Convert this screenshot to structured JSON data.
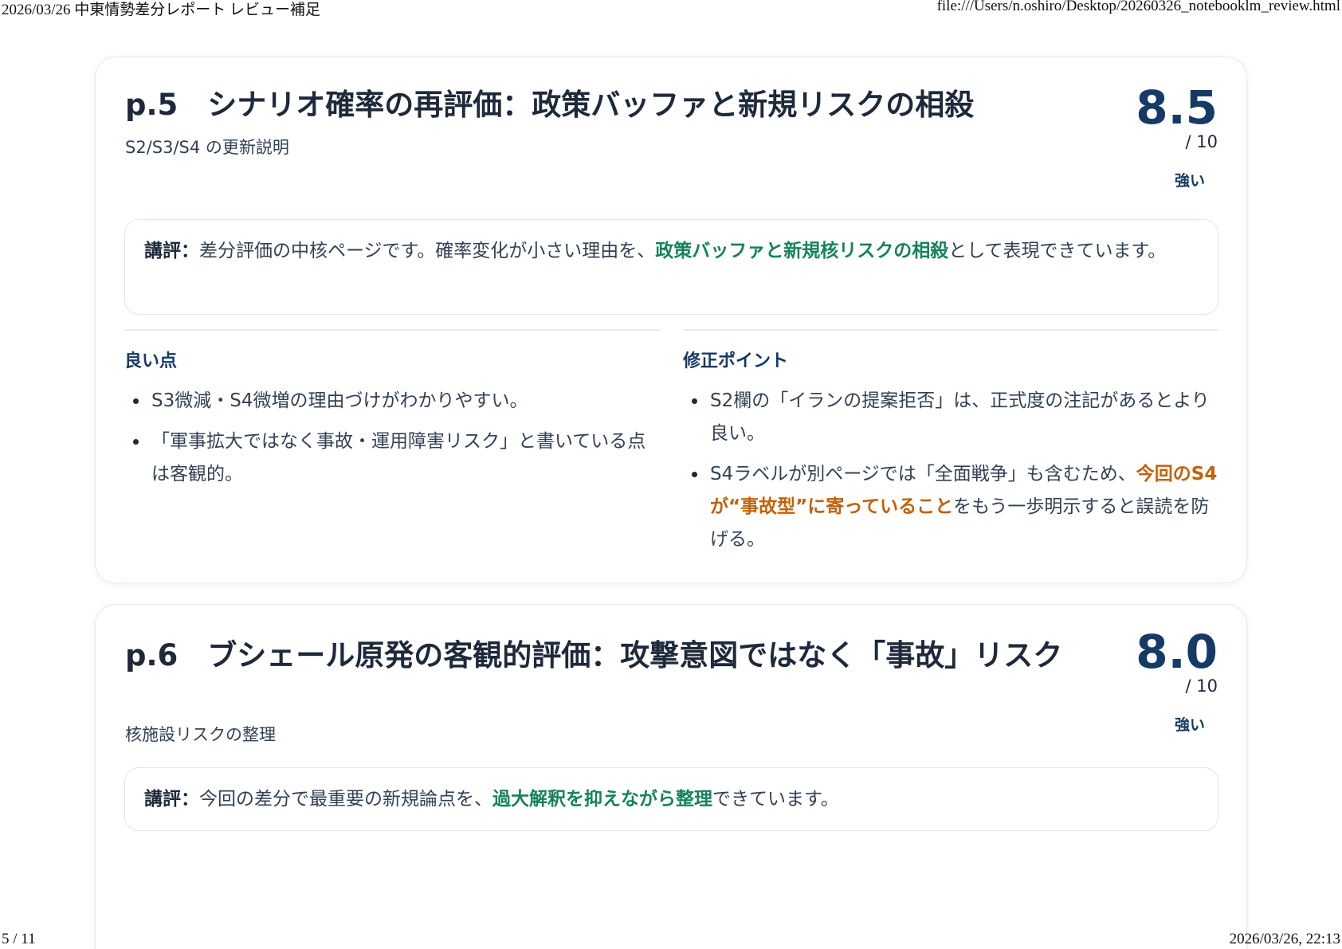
{
  "print_header": {
    "title": "2026/03/26 中東情勢差分レポート レビュー補足",
    "url": "file:///Users/n.oshiro/Desktop/20260326_notebooklm_review.html"
  },
  "print_footer": {
    "page": "5 / 11",
    "datetime": "2026/03/26, 22:13"
  },
  "cards": [
    {
      "title": "p.5　シナリオ確率の再評価：政策バッファと新規リスクの相殺",
      "subtitle": "S2/S3/S4 の更新説明",
      "score": "8.5",
      "score_denominator": "/ 10",
      "grade": "強い",
      "comment": {
        "prefix": "講評：",
        "before": "差分評価の中核ページです。確率変化が小さい理由を、",
        "highlight": "政策バッファと新規核リスクの相殺",
        "after": "として表現できています。"
      },
      "good_points": {
        "heading": "良い点",
        "items": [
          "S3微減・S4微増の理由づけがわかりやすい。",
          "「軍事拡大ではなく事故・運用障害リスク」と書いている点は客観的。"
        ]
      },
      "fix_points": {
        "heading": "修正ポイント",
        "item1": "S2欄の「イランの提案拒否」は、正式度の注記があるとより良い。",
        "item2": {
          "before": "S4ラベルが別ページでは「全面戦争」も含むため、",
          "highlight": "今回のS4が“事故型”に寄っていること",
          "after": "をもう一歩明示すると誤読を防げる。"
        }
      }
    },
    {
      "title": "p.6　ブシェール原発の客観的評価：攻撃意図ではなく「事故」リスク",
      "subtitle": "核施設リスクの整理",
      "score": "8.0",
      "score_denominator": "/ 10",
      "grade": "強い",
      "comment": {
        "prefix": "講評：",
        "before": "今回の差分で最重要の新規論点を、",
        "highlight": "過大解釈を抑えながら整理",
        "after": "できています。"
      }
    }
  ]
}
